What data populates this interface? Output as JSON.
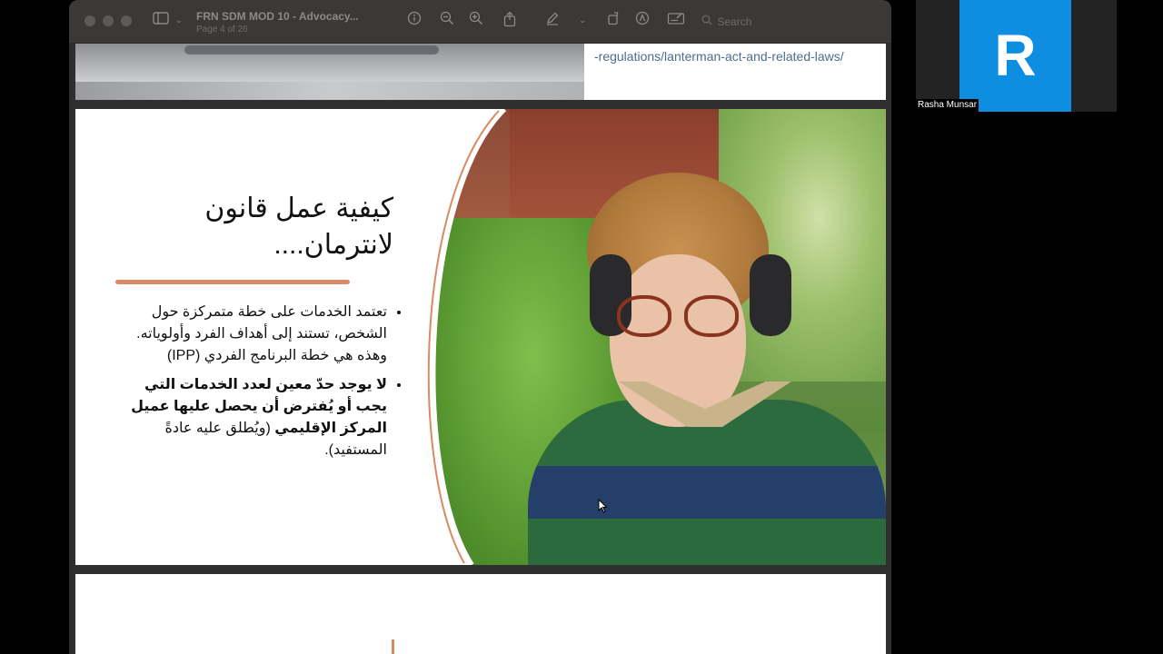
{
  "window": {
    "title": "FRN SDM  MOD 10  - Advocacy...",
    "subtitle": "Page 4 of 26",
    "search_placeholder": "Search"
  },
  "page_top": {
    "link_text": "-regulations/lanterman-act-and-related-laws/"
  },
  "slide": {
    "title": "كيفية عمل قانون لانترمان....",
    "bullets": [
      {
        "text": "تعتمد الخدمات على خطة متمركزة حول الشخص، تستند إلى أهداف الفرد وأولوياته. وهذه هي خطة البرنامج الفردي (IPP)",
        "bold": ""
      },
      {
        "bold": "لا يوجد حدّ معين لعدد الخدمات التي يجب أو يُفترض أن يحصل عليها عميل المركز الإقليمي",
        "text": " (ويُطلق عليه عادةً المستفيد)."
      }
    ]
  },
  "participant": {
    "initial": "R",
    "name": "Rasha Munsar",
    "avatar_color": "#0e8ee0"
  },
  "icons": [
    "sidebar-icon",
    "info-icon",
    "zoom-out-icon",
    "zoom-in-icon",
    "share-icon",
    "markup-pen-icon",
    "rotate-icon",
    "highlight-icon",
    "form-icon",
    "search-icon"
  ],
  "colors": {
    "accent": "#d88a63",
    "link": "#4d6d8a"
  }
}
